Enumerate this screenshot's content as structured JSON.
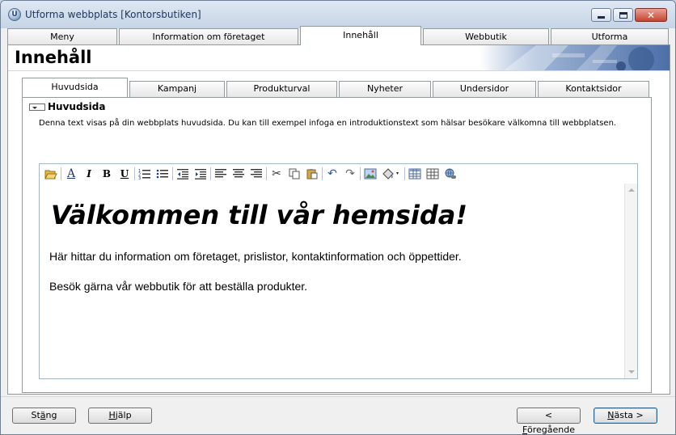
{
  "window": {
    "title": "Utforma webbplats [Kontorsbutiken]",
    "icon": "app-globe-icon"
  },
  "top_tabs": [
    {
      "label": "Meny",
      "active": false
    },
    {
      "label": "Information om företaget",
      "active": false
    },
    {
      "label": "Innehåll",
      "active": true
    },
    {
      "label": "Webbutik",
      "active": false
    },
    {
      "label": "Utforma",
      "active": false
    }
  ],
  "page": {
    "title": "Innehåll"
  },
  "sub_tabs": [
    {
      "label": "Huvudsida",
      "active": true
    },
    {
      "label": "Kampanj",
      "active": false
    },
    {
      "label": "Produkturval",
      "active": false
    },
    {
      "label": "Nyheter",
      "active": false
    },
    {
      "label": "Undersidor",
      "active": false
    },
    {
      "label": "Kontaktsidor",
      "active": false
    }
  ],
  "section": {
    "title": "Huvudsida",
    "description": "Denna text visas på din webbplats huvudsida. Du kan till exempel infoga en introduktionstext som hälsar besökare välkomna till webbplatsen."
  },
  "editor": {
    "heading": "Välkommen till vår hemsida!",
    "paragraphs": [
      "Här hittar du information om företaget, prislistor, kontaktinformation och öppettider.",
      "Besök gärna vår webbutik för att beställa produkter."
    ],
    "toolbar_icons": [
      "open-folder-icon",
      "font-icon",
      "italic-icon",
      "bold-icon",
      "underline-icon",
      "numbered-list-icon",
      "bullet-list-icon",
      "outdent-icon",
      "indent-icon",
      "align-left-icon",
      "align-center-icon",
      "align-right-icon",
      "cut-icon",
      "copy-icon",
      "paste-icon",
      "undo-icon",
      "redo-icon",
      "insert-image-icon",
      "fill-color-icon",
      "insert-table-icon",
      "table-properties-icon",
      "hyperlink-icon"
    ]
  },
  "buttons": {
    "close": {
      "pre": "St",
      "key": "ä",
      "post": "ng"
    },
    "help": {
      "pre": "",
      "key": "H",
      "post": "jälp"
    },
    "prev": {
      "pre": "< ",
      "key": "F",
      "post": "öregående"
    },
    "next": {
      "pre": "",
      "key": "N",
      "post": "ästa >"
    }
  }
}
